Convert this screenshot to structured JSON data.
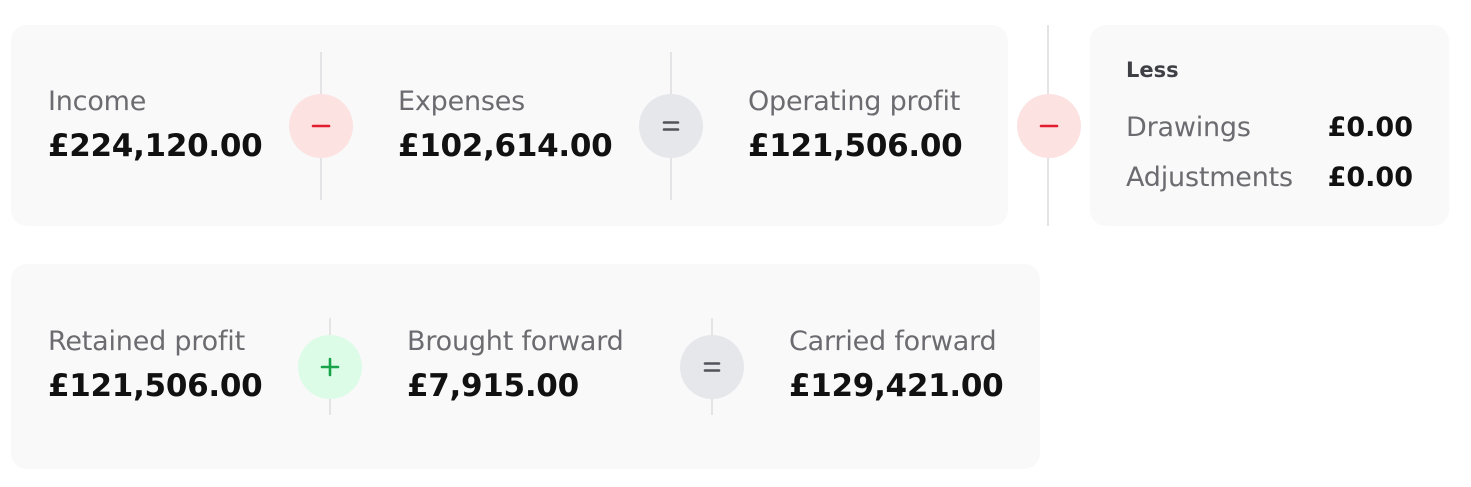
{
  "operating_row": {
    "income": {
      "label": "Income",
      "value": "£224,120.00"
    },
    "op1": {
      "symbol": "minus",
      "color": "#e11d2e"
    },
    "expenses": {
      "label": "Expenses",
      "value": "£102,614.00"
    },
    "op2": {
      "symbol": "equals",
      "color": "#52525b"
    },
    "operating_profit": {
      "label": "Operating profit",
      "value": "£121,506.00"
    }
  },
  "less_operator": {
    "symbol": "minus",
    "color": "#e11d2e"
  },
  "less_panel": {
    "title": "Less",
    "items": [
      {
        "label": "Drawings",
        "value": "£0.00"
      },
      {
        "label": "Adjustments",
        "value": "£0.00"
      }
    ]
  },
  "retained_row": {
    "retained_profit": {
      "label": "Retained profit",
      "value": "£121,506.00"
    },
    "op1": {
      "symbol": "plus",
      "color": "#16a34a"
    },
    "brought_forward": {
      "label": "Brought forward",
      "value": "£7,915.00"
    },
    "op2": {
      "symbol": "equals",
      "color": "#52525b"
    },
    "carried_forward": {
      "label": "Carried forward",
      "value": "£129,421.00"
    }
  }
}
